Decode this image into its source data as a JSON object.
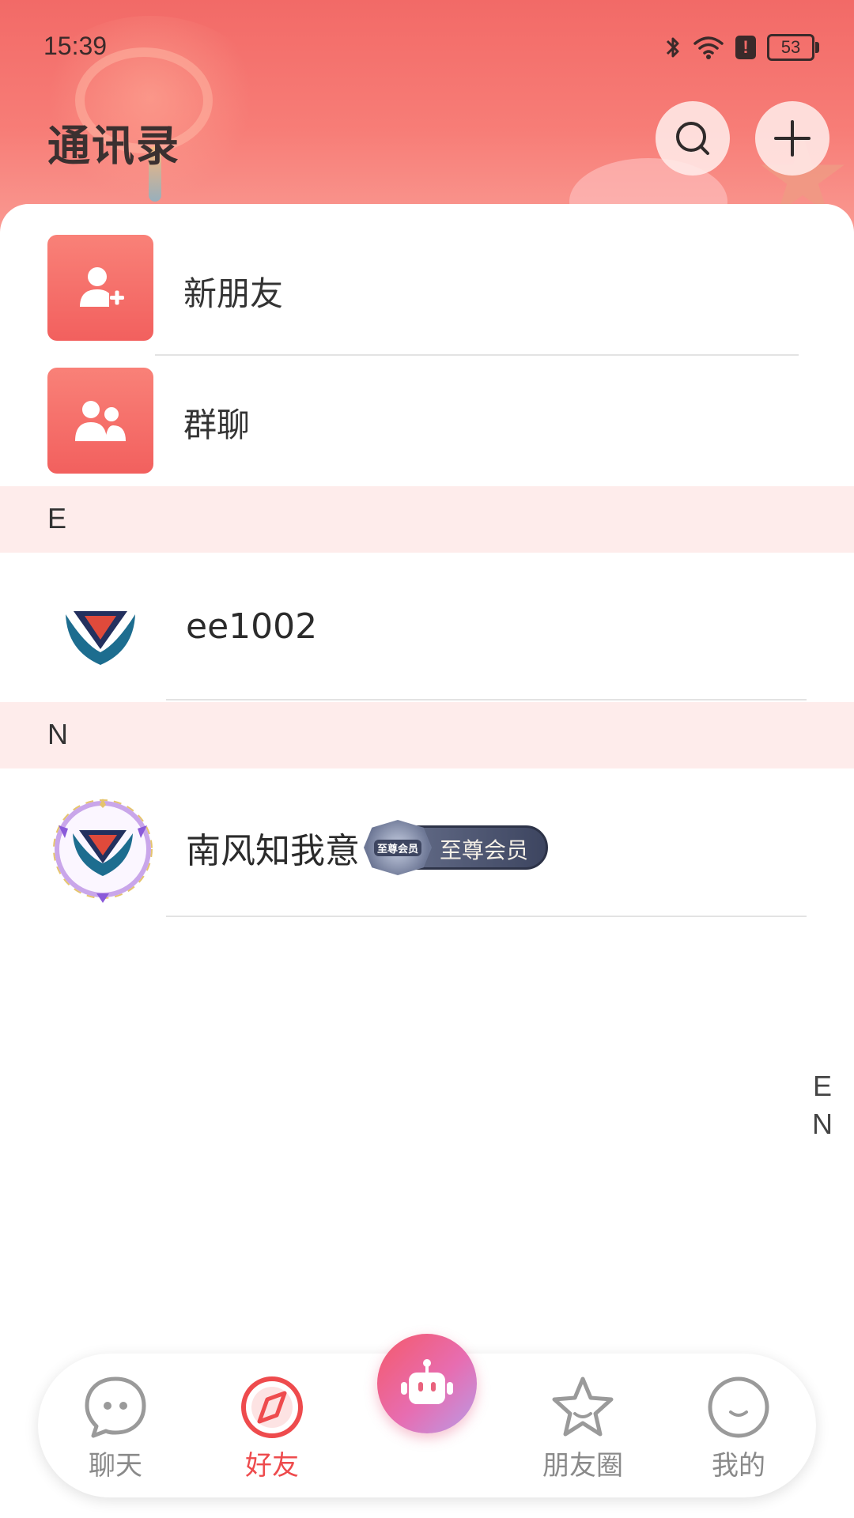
{
  "status_bar": {
    "time": "15:39",
    "battery": "53"
  },
  "header": {
    "title": "通讯录"
  },
  "menu": {
    "new_friends": "新朋友",
    "group_chat": "群聊"
  },
  "sections": [
    {
      "letter": "E",
      "contacts": [
        {
          "name": "ee1002",
          "badge": ""
        }
      ]
    },
    {
      "letter": "N",
      "contacts": [
        {
          "name": "南风知我意",
          "badge": "至尊会员",
          "badge_emblem": "至尊会员"
        }
      ]
    }
  ],
  "index_bar": [
    "E",
    "N"
  ],
  "bottom_nav": {
    "items": [
      {
        "label": "聊天",
        "icon": "chat-bubble-icon",
        "active": false
      },
      {
        "label": "好友",
        "icon": "compass-icon",
        "active": true
      },
      {
        "label": "朋友圈",
        "icon": "star-icon",
        "active": false
      },
      {
        "label": "我的",
        "icon": "smile-icon",
        "active": false
      }
    ],
    "center_icon": "robot-icon"
  },
  "colors": {
    "accent": "#ee4b4d",
    "header_bg": "#f26a67",
    "section_bg": "#feeceb",
    "inactive": "#8a8a8a"
  }
}
